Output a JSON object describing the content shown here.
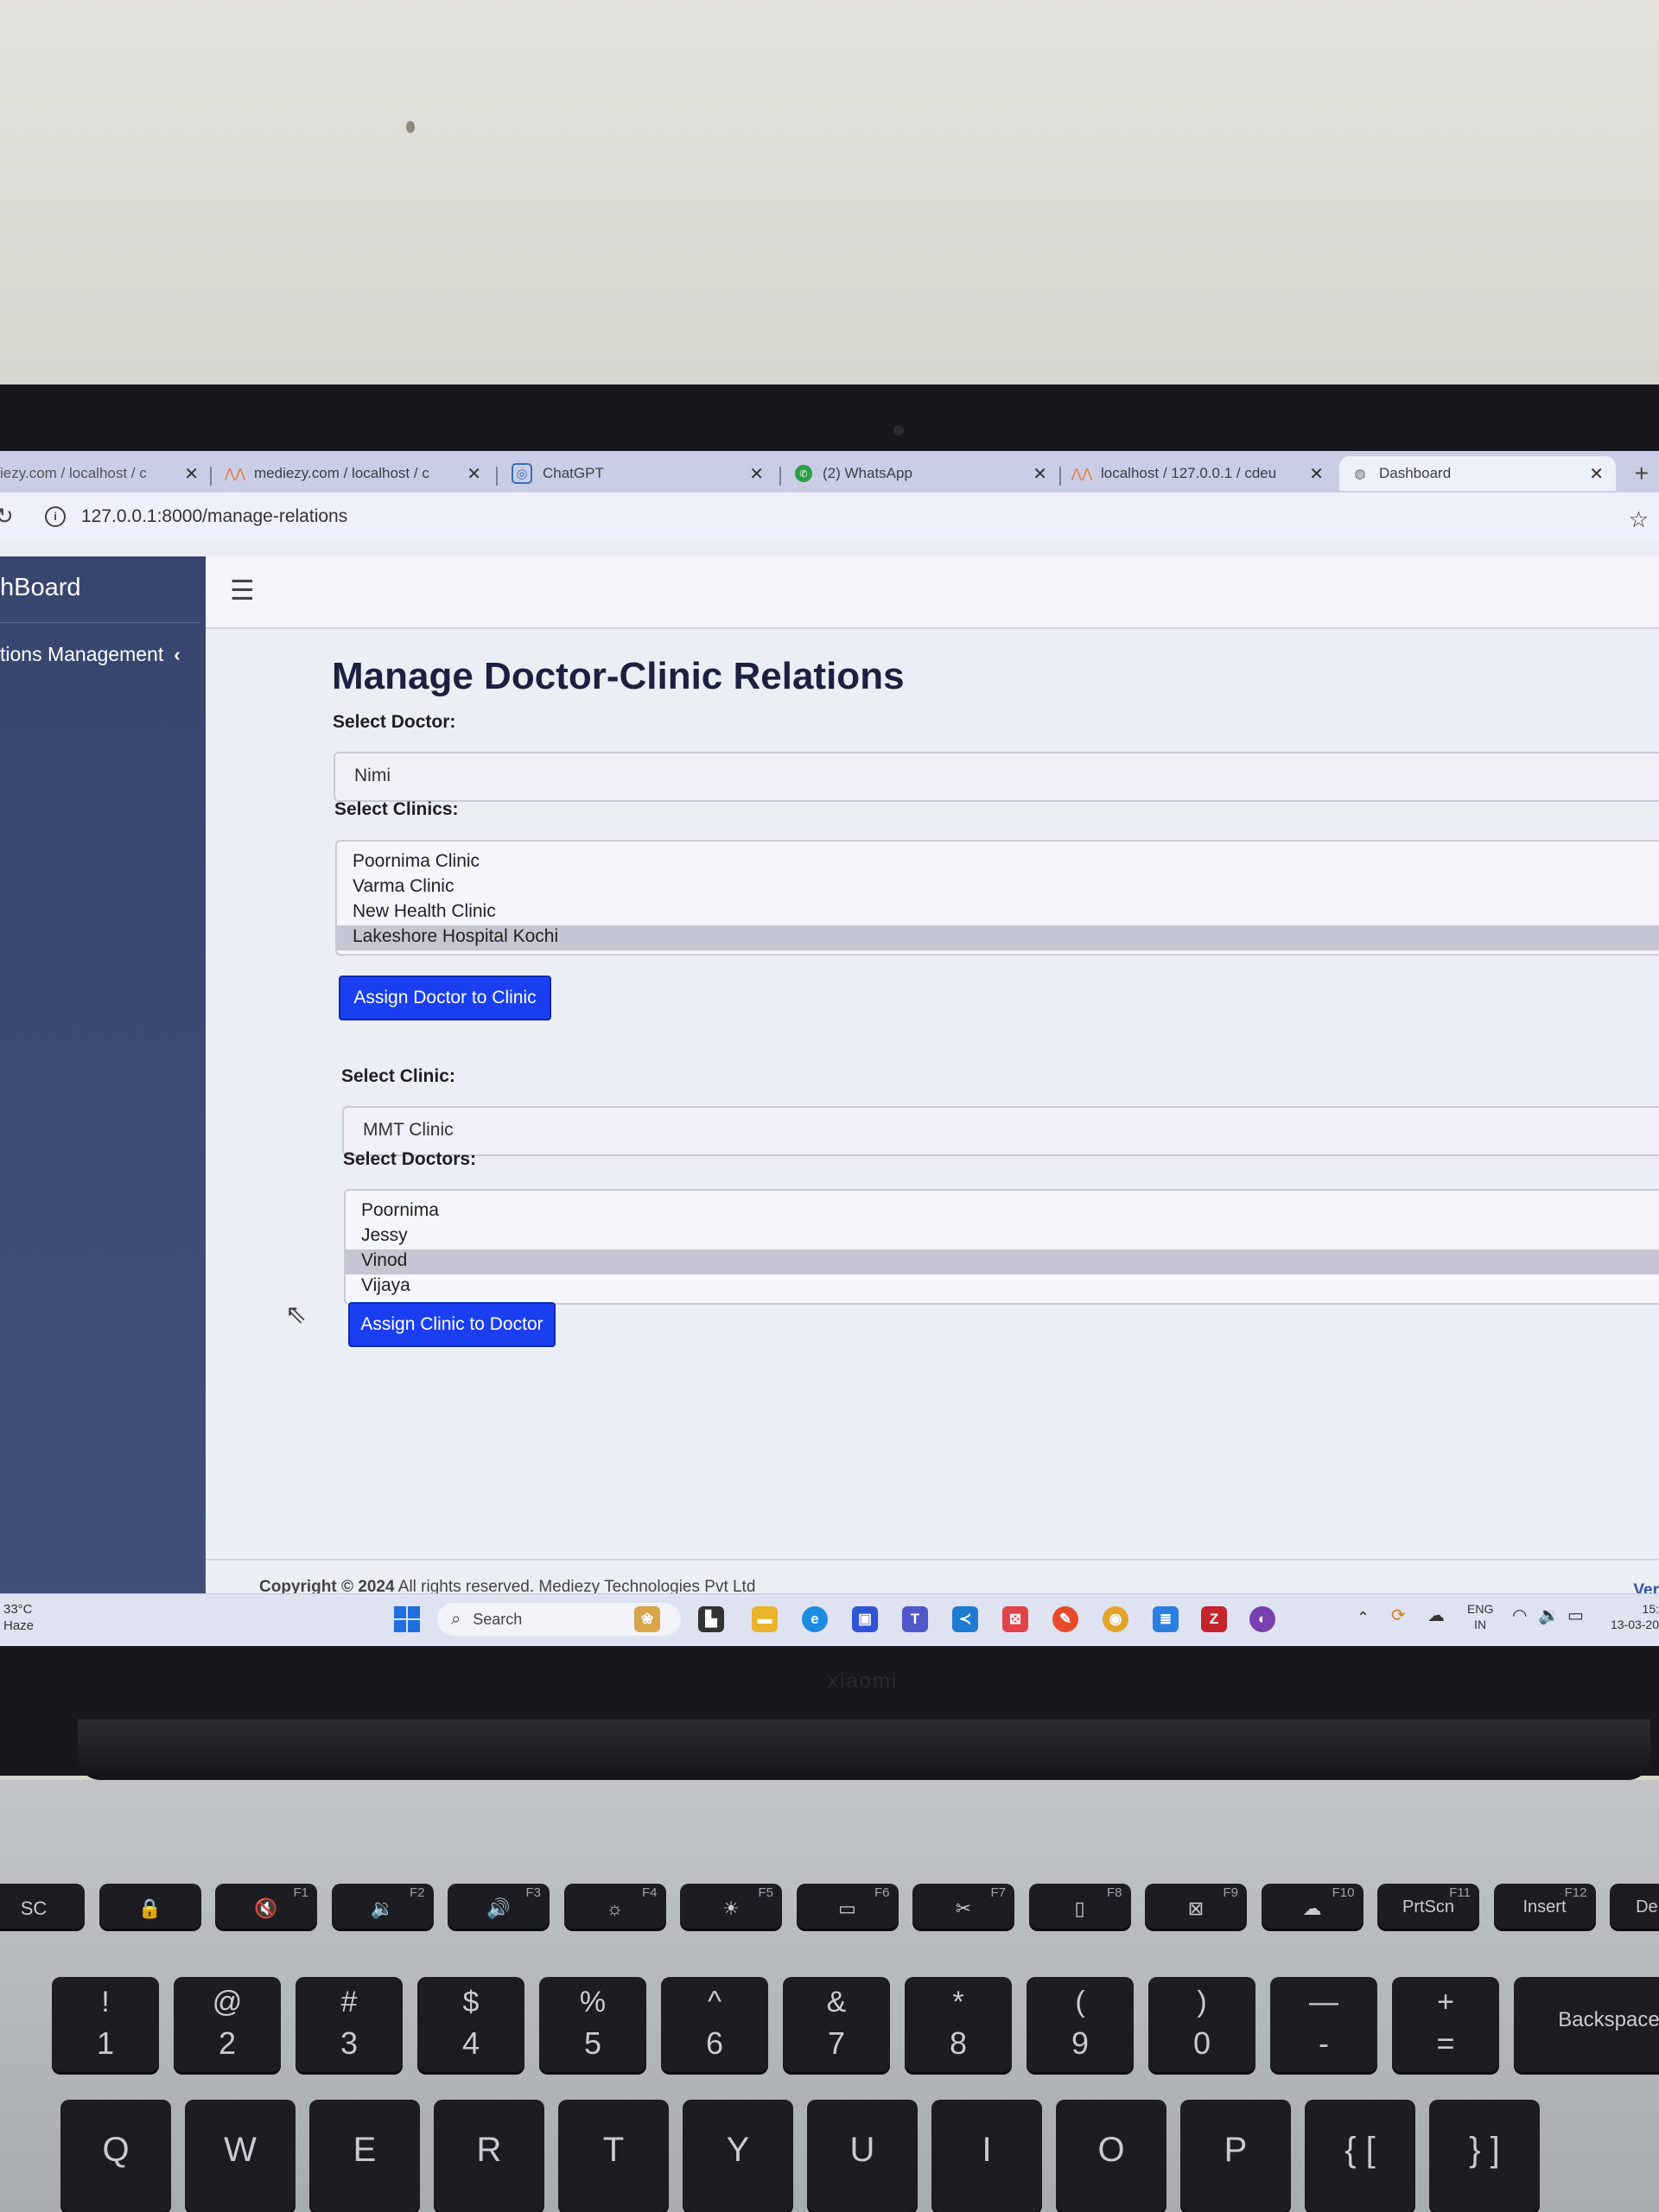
{
  "browser": {
    "tabs": [
      {
        "label": "iezy.com / localhost / c",
        "icon": "none"
      },
      {
        "label": "mediezy.com / localhost / c",
        "icon": "phpmyadmin-icon"
      },
      {
        "label": "ChatGPT",
        "icon": "chatgpt-icon"
      },
      {
        "label": "(2) WhatsApp",
        "icon": "whatsapp-icon"
      },
      {
        "label": "localhost / 127.0.0.1 / cdeu",
        "icon": "phpmyadmin-icon"
      },
      {
        "label": "Dashboard",
        "icon": "globe-icon",
        "active": true
      }
    ],
    "close_glyph": "✕",
    "new_tab_glyph": "+",
    "url": "127.0.0.1:8000/manage-relations"
  },
  "sidebar": {
    "brand": "hBoard",
    "nav_item": "tions Management",
    "nav_chevron": "‹"
  },
  "topbar": {
    "menu_glyph": "☰"
  },
  "page": {
    "title": "Manage Doctor-Clinic Relations",
    "assign_doctor_form": {
      "doctor_label": "Select Doctor:",
      "doctor_value": "Nimi",
      "clinics_label": "Select Clinics:",
      "clinics": [
        "Poornima Clinic",
        "Varma Clinic",
        "New Health Clinic",
        "Lakeshore Hospital Kochi"
      ],
      "selected_clinic": "Lakeshore Hospital Kochi",
      "button": "Assign Doctor to Clinic"
    },
    "assign_clinic_form": {
      "clinic_label": "Select Clinic:",
      "clinic_value": "MMT Clinic",
      "doctors_label": "Select Doctors:",
      "doctors": [
        "Poornima",
        "Jessy",
        "Vinod",
        "Vijaya"
      ],
      "selected_doctor": "Vinod",
      "button": "Assign Clinic to Doctor"
    }
  },
  "footer": {
    "copyright_bold": "Copyright © 2024",
    "copyright_rest": " All rights reserved. Mediezy Technologies Pvt Ltd",
    "right": "Ver"
  },
  "taskbar": {
    "weather_temp": "33°C",
    "weather_desc": "Haze",
    "search_placeholder": "Search",
    "tray_lang_1": "ENG",
    "tray_lang_2": "IN",
    "clock_time": "15:",
    "clock_date": "13-03-20"
  },
  "laptop": {
    "brand": "xiaomi",
    "function_keys": [
      {
        "main": "SC",
        "fn": ""
      },
      {
        "main": "🔒",
        "fn": ""
      },
      {
        "main": "🔇",
        "fn": "F1"
      },
      {
        "main": "🔉",
        "fn": "F2"
      },
      {
        "main": "🔊",
        "fn": "F3"
      },
      {
        "main": "☼",
        "fn": "F4"
      },
      {
        "main": "☀",
        "fn": "F5"
      },
      {
        "main": "▭",
        "fn": "F6"
      },
      {
        "main": "✂",
        "fn": "F7"
      },
      {
        "main": "▯",
        "fn": "F8"
      },
      {
        "main": "⊠",
        "fn": "F9"
      },
      {
        "main": "☁",
        "fn": "F10"
      },
      {
        "main": "PrtScn",
        "fn": "F11"
      },
      {
        "main": "Insert",
        "fn": "F12"
      },
      {
        "main": "Delete",
        "fn": ""
      }
    ],
    "number_keys": [
      {
        "top": "!",
        "bottom": "1"
      },
      {
        "top": "@",
        "bottom": "2"
      },
      {
        "top": "#",
        "bottom": "3"
      },
      {
        "top": "$",
        "bottom": "4"
      },
      {
        "top": "%",
        "bottom": "5"
      },
      {
        "top": "^",
        "bottom": "6"
      },
      {
        "top": "&",
        "bottom": "7"
      },
      {
        "top": "*",
        "bottom": "8"
      },
      {
        "top": "(",
        "bottom": "9"
      },
      {
        "top": ")",
        "bottom": "0"
      },
      {
        "top": "—",
        "bottom": "-"
      },
      {
        "top": "+",
        "bottom": "="
      },
      {
        "top": "Backspace",
        "bottom": ""
      }
    ],
    "letter_keys": [
      "Q",
      "W",
      "E",
      "R",
      "T",
      "Y",
      "U",
      "I",
      "O",
      "P",
      "{ [",
      "} ]"
    ]
  }
}
